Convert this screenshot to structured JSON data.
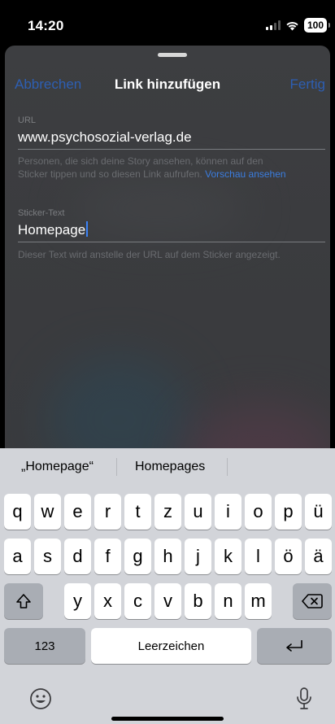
{
  "status_bar": {
    "time": "14:20",
    "battery": "100"
  },
  "nav": {
    "cancel": "Abbrechen",
    "title": "Link hinzufügen",
    "done": "Fertig"
  },
  "url_field": {
    "label": "URL",
    "value": "www.psychosozial-verlag.de",
    "helper_line1": "Personen, die sich deine Story ansehen, können auf den",
    "helper_line2": "Sticker tippen und so diesen Link aufrufen.",
    "preview_link": "Vorschau ansehen"
  },
  "sticker_field": {
    "label": "Sticker-Text",
    "value": "Homepage",
    "helper": "Dieser Text wird anstelle der URL auf dem Sticker angezeigt."
  },
  "keyboard": {
    "suggestions": [
      "„Homepage“",
      "Homepages"
    ],
    "row1": [
      "q",
      "w",
      "e",
      "r",
      "t",
      "z",
      "u",
      "i",
      "o",
      "p",
      "ü"
    ],
    "row2": [
      "a",
      "s",
      "d",
      "f",
      "g",
      "h",
      "j",
      "k",
      "l",
      "ö",
      "ä"
    ],
    "row3": [
      "y",
      "x",
      "c",
      "v",
      "b",
      "n",
      "m"
    ],
    "numbers_key": "123",
    "space_key": "Leerzeichen",
    "icons": {
      "shift": "shift-icon",
      "delete": "delete-icon",
      "return": "return-icon",
      "emoji": "emoji-icon",
      "dictation": "microphone-icon"
    }
  },
  "colors": {
    "accent": "#3b7de0",
    "nav_button": "#2d5fb3",
    "keyboard_bg": "#d2d4d9"
  }
}
